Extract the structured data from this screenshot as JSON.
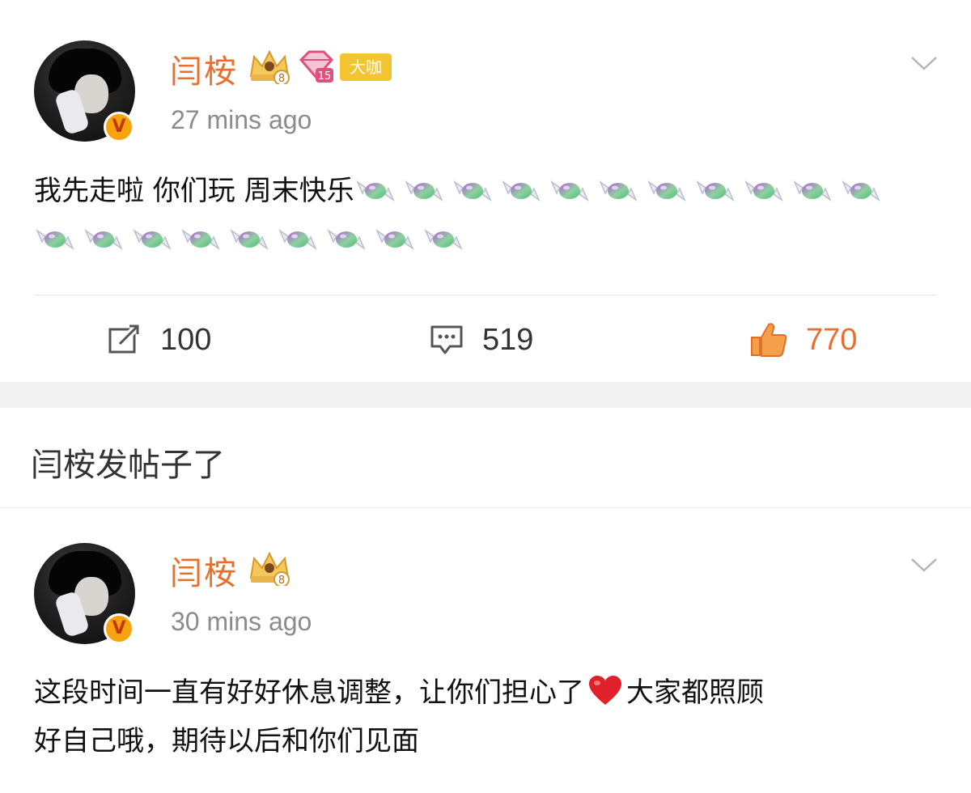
{
  "post1": {
    "author": "闫桉",
    "badge_text": "大咖",
    "crown_level": "8",
    "gem_level": "15",
    "verified_mark": "V",
    "time": "27 mins ago",
    "text": "我先走啦 你们玩 周末快乐",
    "emoji_icon": "candy-emoji",
    "emoji_count": 20,
    "actions": {
      "repost": "100",
      "comment": "519",
      "like": "770"
    }
  },
  "notice": {
    "text": "闫桉发帖子了"
  },
  "post2": {
    "author": "闫桉",
    "crown_level": "8",
    "verified_mark": "V",
    "time": "30 mins ago",
    "text_line1_a": "这段时间一直有好好休息调整，让你们担心了",
    "text_line1_b": "大家都照顾",
    "text_line2": "好自己哦，期待以后和你们见面",
    "emoji_icon": "red-heart-emoji"
  },
  "colors": {
    "name": "#e9702c",
    "like": "#e9702c",
    "time": "#8b8b8b",
    "badge": "#f5c433"
  }
}
